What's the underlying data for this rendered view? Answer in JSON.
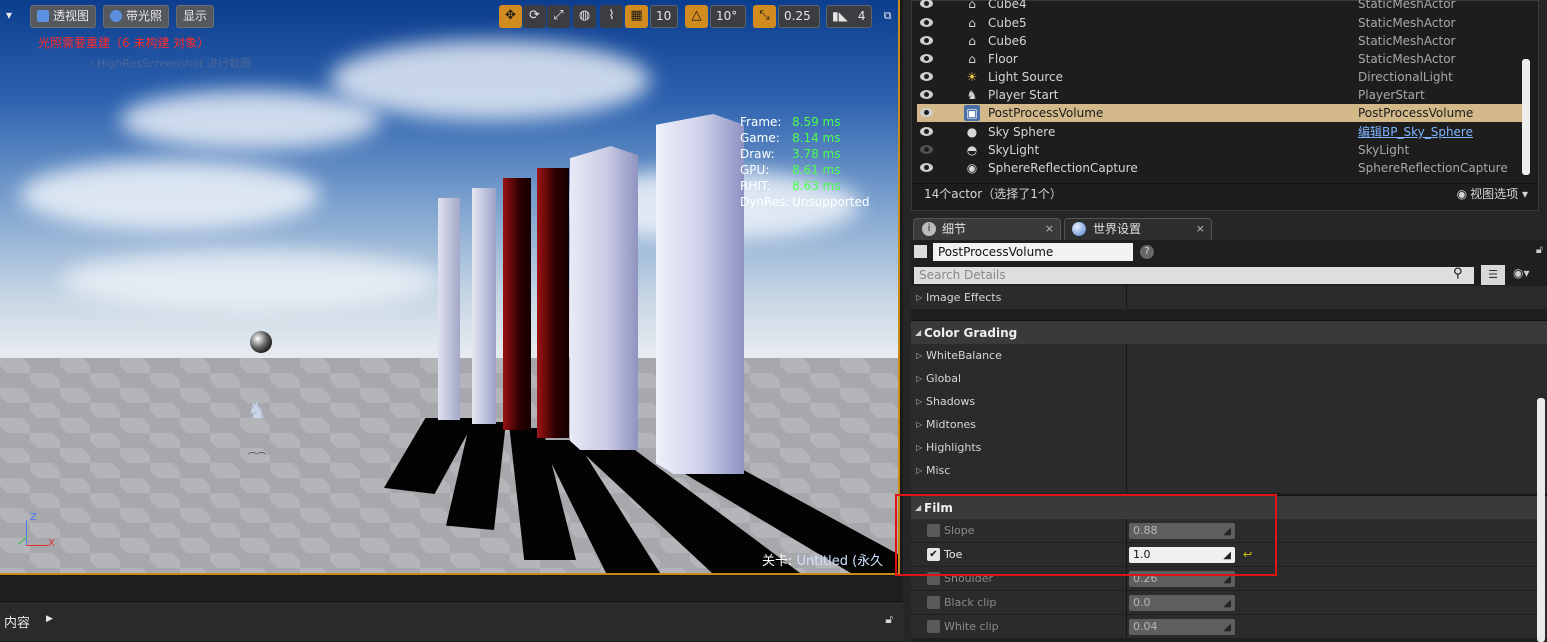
{
  "viewport": {
    "buttons": {
      "perspective": "透视图",
      "lit": "带光照",
      "show": "显示"
    },
    "toolbar": {
      "grid_snap": "10",
      "rotate_snap": "10°",
      "scale_snap": "0.25",
      "camera_speed": "4"
    },
    "warning": "光照需要重建（6 未构建 对象）",
    "ghost_text": "r.HighResScreenshot 进行截图",
    "stats": [
      {
        "label": "Frame:",
        "value": "8.59 ms"
      },
      {
        "label": "Game:",
        "value": "8.14 ms"
      },
      {
        "label": "Draw:",
        "value": "3.78 ms"
      },
      {
        "label": "GPU:",
        "value": "8.61 ms"
      },
      {
        "label": "RHIT:",
        "value": "8.63 ms"
      },
      {
        "label": "DynRes:",
        "value": "Unsupported"
      }
    ],
    "level_label": "关卡:",
    "level_name": "Untitled (永久性)",
    "axis": {
      "z": "Z",
      "x": "X"
    }
  },
  "content_bar": {
    "label": "内容"
  },
  "outliner": {
    "rows": [
      {
        "name": "Cube4",
        "type": "StaticMeshActor"
      },
      {
        "name": "Cube5",
        "type": "StaticMeshActor"
      },
      {
        "name": "Cube6",
        "type": "StaticMeshActor"
      },
      {
        "name": "Floor",
        "type": "StaticMeshActor"
      },
      {
        "name": "Light Source",
        "type": "DirectionalLight"
      },
      {
        "name": "Player Start",
        "type": "PlayerStart"
      },
      {
        "name": "PostProcessVolume",
        "type": "PostProcessVolume"
      },
      {
        "name": "Sky Sphere",
        "type": "编辑BP_Sky_Sphere"
      },
      {
        "name": "SkyLight",
        "type": "SkyLight"
      },
      {
        "name": "SphereReflectionCapture",
        "type": "SphereReflectionCapture"
      }
    ],
    "footer": "14个actor（选择了1个）",
    "view_options": "视图选项"
  },
  "tabs": {
    "details": "细节",
    "world_settings": "世界设置"
  },
  "details": {
    "object_name": "PostProcessVolume",
    "search_placeholder": "Search Details",
    "image_effects": "Image Effects",
    "color_grading": "Color Grading",
    "grading_items": [
      "WhiteBalance",
      "Global",
      "Shadows",
      "Midtones",
      "Highlights",
      "Misc"
    ],
    "film": "Film",
    "film_rows": [
      {
        "label": "Slope",
        "value": "0.88"
      },
      {
        "label": "Toe",
        "value": "1.0"
      },
      {
        "label": "Shoulder",
        "value": "0.26"
      },
      {
        "label": "Black clip",
        "value": "0.0"
      },
      {
        "label": "White clip",
        "value": "0.04"
      }
    ]
  },
  "colors": {
    "accent_orange": "#c68c1a",
    "selection": "#d3b98a",
    "highlight_red": "#e01414",
    "stat_green": "#4cff4c"
  }
}
